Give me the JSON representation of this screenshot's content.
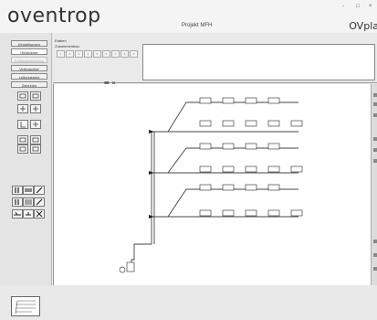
{
  "header": {
    "logo": "oventrop",
    "project_title": "Projekt MFH",
    "app_name": "OVpla",
    "window_controls": [
      "-",
      "□",
      "×"
    ]
  },
  "sidebar": {
    "nav_items": [
      {
        "label": "Einstellungen",
        "state": "normal"
      },
      {
        "label": "Heizkörper",
        "state": "active"
      },
      {
        "label": "Fußbodenheizung",
        "state": "disabled"
      },
      {
        "label": "Verbraucher",
        "state": "normal"
      },
      {
        "label": "Leitungsnetz",
        "state": "normal"
      },
      {
        "label": "Zeichnen",
        "state": "normal"
      }
    ]
  },
  "top_panel": {
    "label_1": "Etaben",
    "label_2": "Zusammenbau",
    "slot_labels": [
      "1",
      "2",
      "3",
      "4",
      "5",
      "6",
      "7",
      "8",
      "9",
      "10"
    ]
  },
  "icons": {
    "tools": [
      "radiator-icon",
      "pipe-icon",
      "valve-icon",
      "pump-icon",
      "delete-icon"
    ]
  }
}
